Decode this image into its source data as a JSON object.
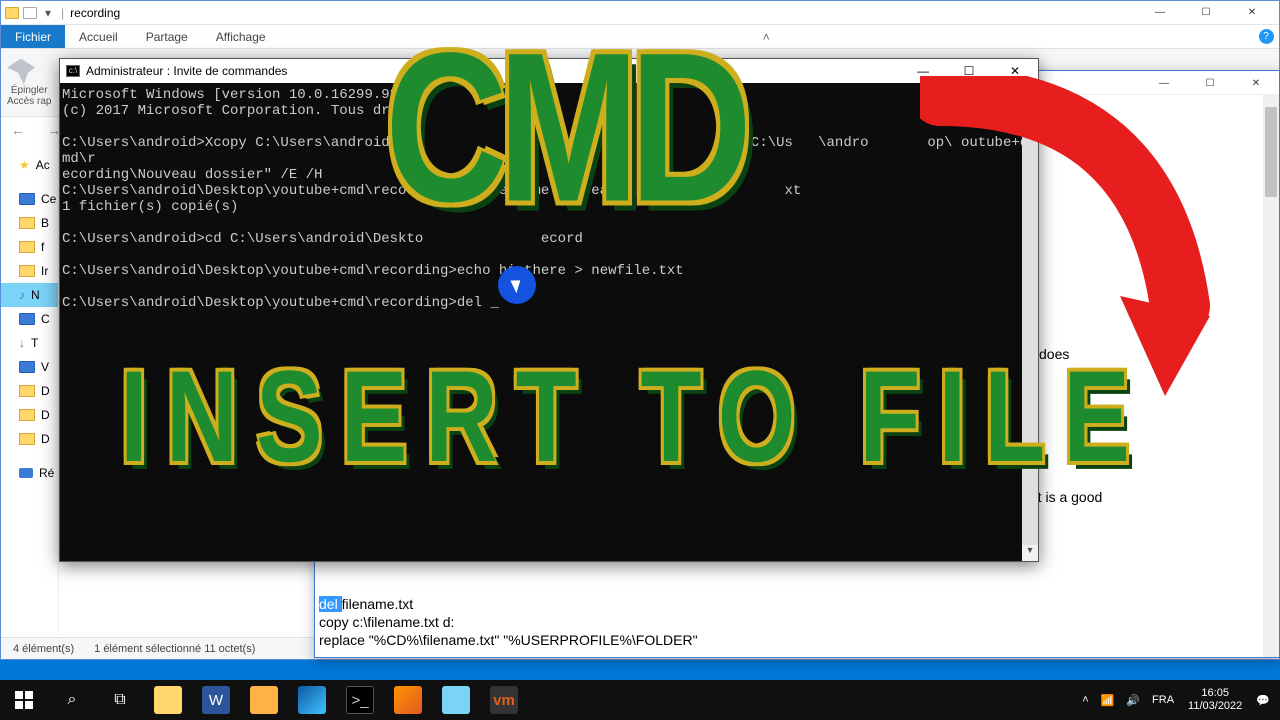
{
  "explorer": {
    "title": "recording",
    "ribbon": {
      "file": "Fichier",
      "home": "Accueil",
      "share": "Partage",
      "view": "Affichage"
    },
    "pin": {
      "line1": "Épingler",
      "line2": "Accès rap"
    },
    "nav": {
      "back": "←",
      "fwd": "→"
    },
    "sidebar": [
      "Ac",
      "Ce",
      "B",
      "f",
      "Ir",
      "N",
      "C",
      "T",
      "V",
      "D",
      "D",
      "D",
      "Ré"
    ],
    "status": {
      "count": "4 élément(s)",
      "sel": "1 élément sélectionné  11 octet(s)"
    }
  },
  "notepad": {
    "text_partial1": "does",
    "text_partial2": "h, it is a good",
    "snippet": {
      "del": "del ",
      "line1": "filename.txt",
      "line2": "copy c:\\filename.txt d:",
      "line3": "replace \"%CD%\\filename.txt\" \"%USERPROFILE%\\FOLDER\""
    }
  },
  "cmd": {
    "title": "Administrateur : Invite de commandes",
    "body": "Microsoft Windows [version 10.0.16299.98]\n(c) 2017 Microsoft Corporation. Tous droits\n\nC:\\Users\\android>Xcopy C:\\Users\\android\\Des              \\reco                    C:\\Us   \\andro       op\\ outube+cmd\\r\necording\\Nouveau dossier\" /E /H\nC:\\Users\\android\\Desktop\\youtube+cmd\\record      oldername\\Nouvea                     xt\n1 fichier(s) copié(s)\n\nC:\\Users\\android>cd C:\\Users\\android\\Deskto              ecord\n\nC:\\Users\\android\\Desktop\\youtube+cmd\\recording>echo hi there > newfile.txt\n\nC:\\Users\\android\\Desktop\\youtube+cmd\\recording>del _"
  },
  "overlay": {
    "cmd": "CMD",
    "insert": "INSERT TO FILE"
  },
  "tray": {
    "lang": "FRA",
    "time": "16:05",
    "date": "11/03/2022"
  }
}
